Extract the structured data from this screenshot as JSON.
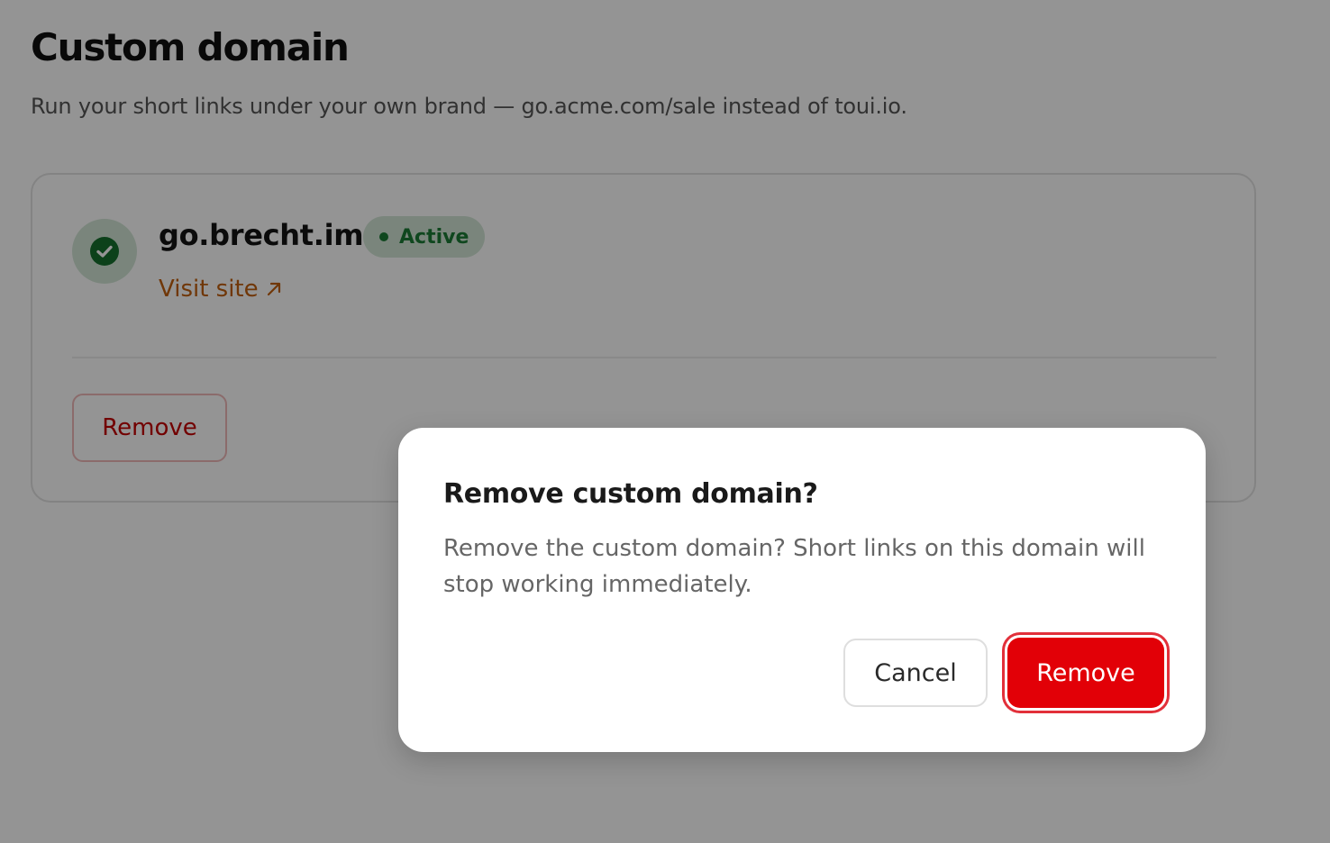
{
  "page": {
    "title": "Custom domain",
    "subtitle": "Run your short links under your own brand — go.acme.com/sale instead of toui.io."
  },
  "domain_card": {
    "status_icon": "check-circle-icon",
    "domain": "go.brecht.im",
    "status_label": "Active",
    "status_color": "#1b7a35",
    "visit_label": "Visit site",
    "visit_icon": "arrow-up-right-icon",
    "remove_label": "Remove"
  },
  "dialog": {
    "title": "Remove custom domain?",
    "message": "Remove the custom domain? Short links on this domain will stop working immediately.",
    "cancel_label": "Cancel",
    "confirm_label": "Remove",
    "danger_color": "#e20007"
  }
}
